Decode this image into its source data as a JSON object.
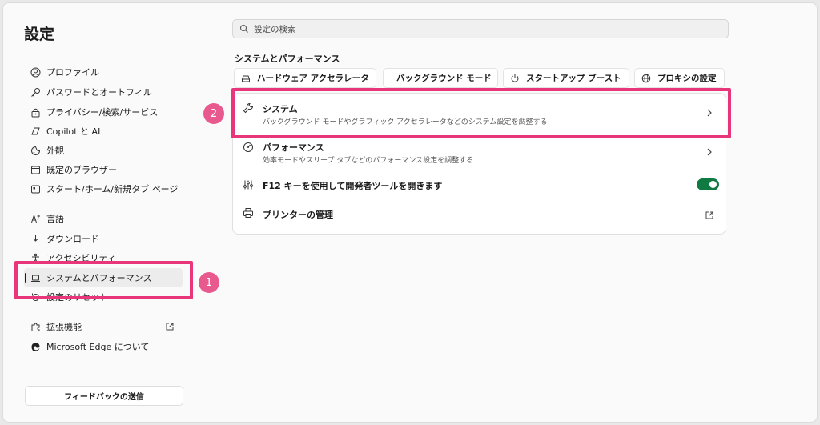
{
  "page": {
    "title": "設定"
  },
  "sidebar": {
    "items": [
      {
        "label": "プロファイル",
        "icon": "profile-icon"
      },
      {
        "label": "パスワードとオートフィル",
        "icon": "key-icon"
      },
      {
        "label": "プライバシー/検索/サービス",
        "icon": "lock-icon"
      },
      {
        "label": "Copilot と AI",
        "icon": "copilot-icon"
      },
      {
        "label": "外観",
        "icon": "appearance-icon"
      },
      {
        "label": "既定のブラウザー",
        "icon": "browser-icon"
      },
      {
        "label": "スタート/ホーム/新規タブ ページ",
        "icon": "home-icon"
      },
      {
        "label": "言語",
        "icon": "language-icon"
      },
      {
        "label": "ダウンロード",
        "icon": "download-icon"
      },
      {
        "label": "アクセシビリティ",
        "icon": "accessibility-icon"
      },
      {
        "label": "システムとパフォーマンス",
        "icon": "laptop-icon",
        "active": true
      },
      {
        "label": "設定のリセット",
        "icon": "reset-icon"
      },
      {
        "label": "拡張機能",
        "icon": "puzzle-icon"
      },
      {
        "label": "Microsoft Edge について",
        "icon": "edge-icon"
      }
    ],
    "feedback_label": "フィードバックの送信"
  },
  "search": {
    "placeholder": "設定の検索"
  },
  "main": {
    "section_title": "システムとパフォーマンス",
    "chips": [
      {
        "label": "ハードウェア アクセラレータ",
        "icon": "hardware-icon"
      },
      {
        "label": "バックグラウンド モード",
        "icon": "background-icon"
      },
      {
        "label": "スタートアップ ブースト",
        "icon": "power-icon"
      },
      {
        "label": "プロキシの設定",
        "icon": "globe-icon"
      }
    ],
    "rows": [
      {
        "title": "システム",
        "subtitle": "バックグラウンド モードやグラフィック アクセラレータなどのシステム設定を調整する",
        "icon": "wrench-icon"
      },
      {
        "title": "パフォーマンス",
        "subtitle": "効率モードやスリープ タブなどのパフォーマンス設定を調整する",
        "icon": "performance-icon"
      },
      {
        "title": "F12 キーを使用して開発者ツールを開きます",
        "icon": "devtools-icon",
        "toggle_on": true
      },
      {
        "title": "プリンターの管理",
        "icon": "printer-icon"
      }
    ]
  },
  "annotations": {
    "badge1": "1",
    "badge2": "2"
  },
  "colors": {
    "accent_toggle": "#0f7b42",
    "highlight": "#e8367a",
    "badge": "#e85a8e"
  }
}
